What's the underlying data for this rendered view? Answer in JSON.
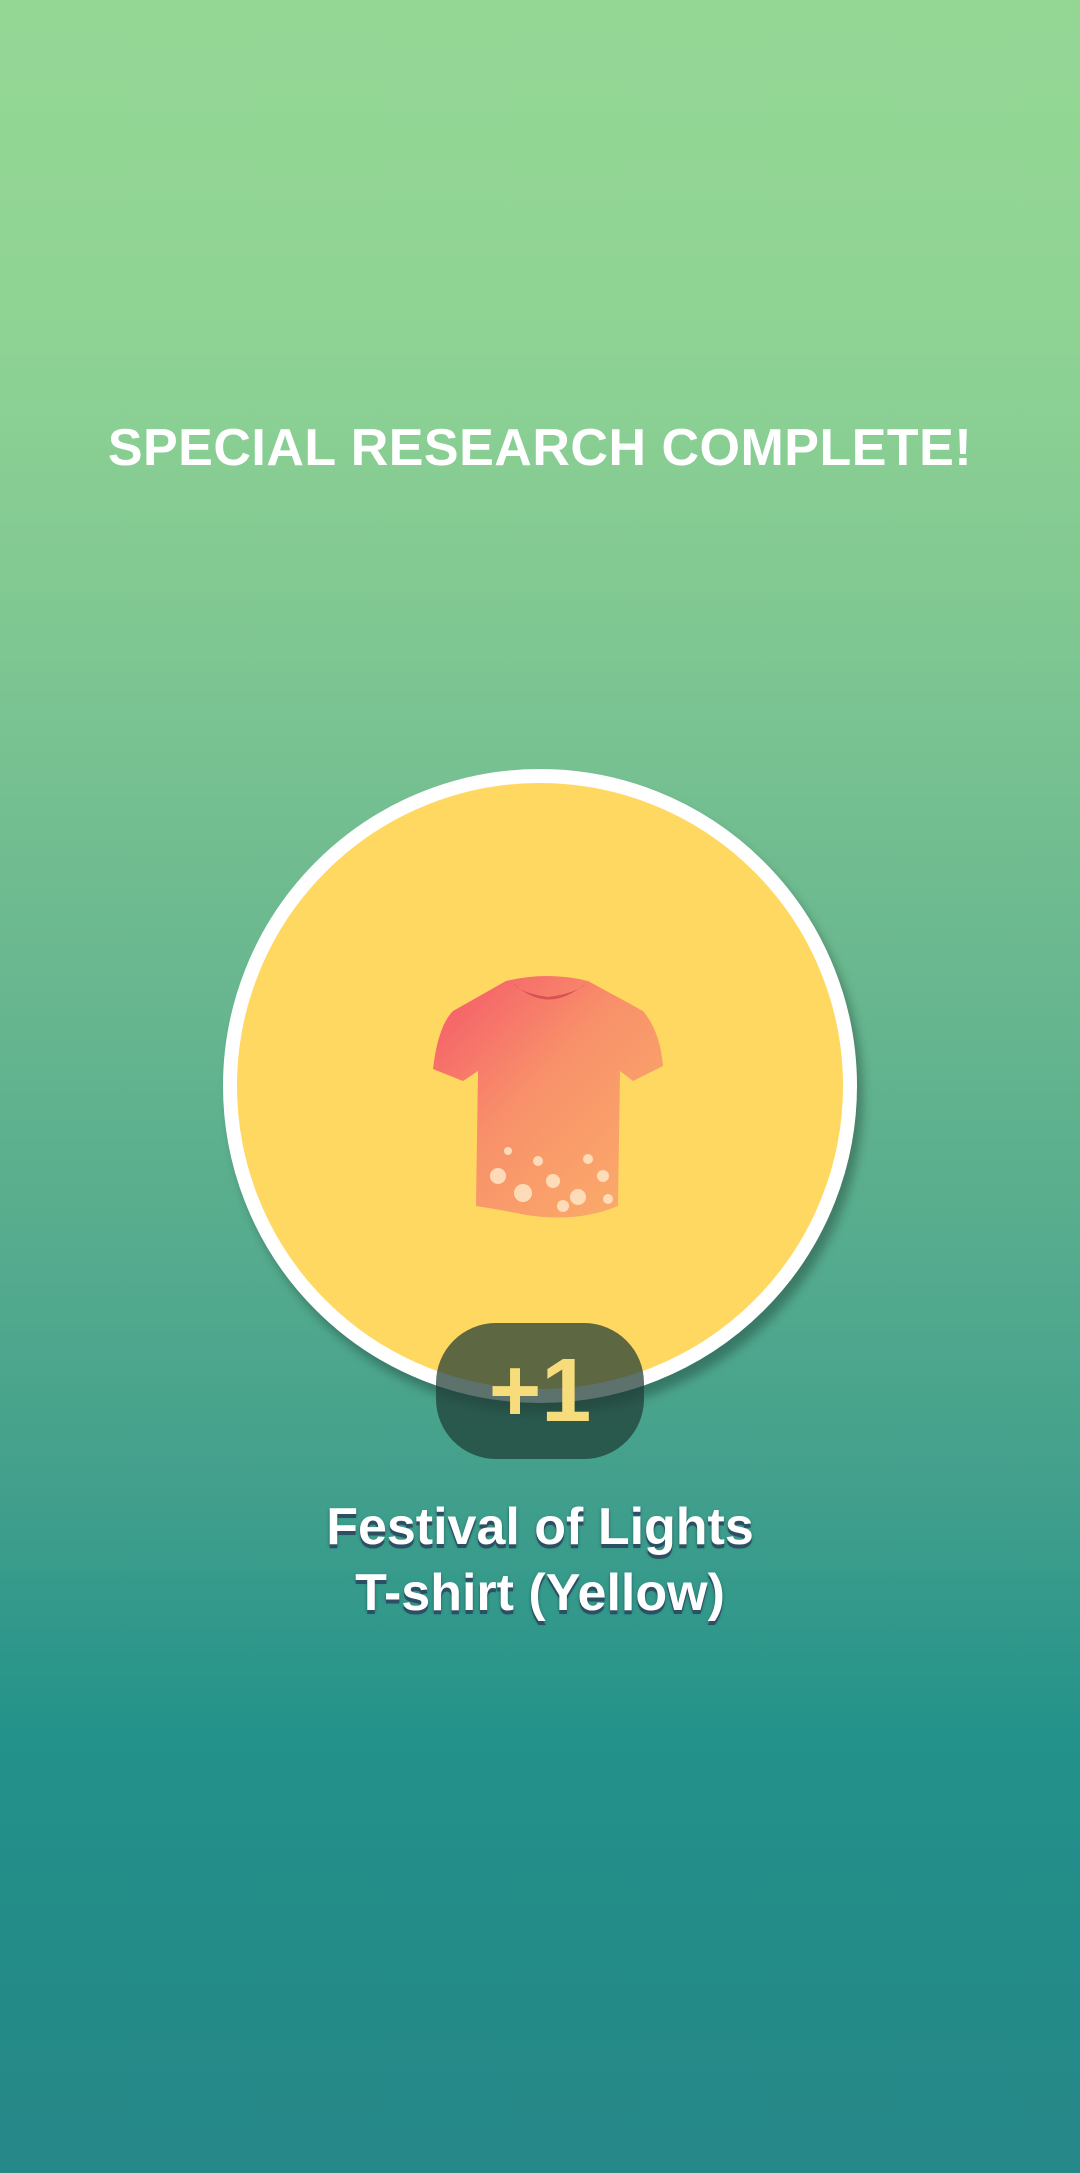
{
  "header": {
    "title": "SPECIAL RESEARCH COMPLETE!"
  },
  "reward": {
    "icon": "tshirt-icon",
    "count": "+1",
    "name_line1": "Festival of Lights",
    "name_line2": "T-shirt (Yellow)"
  },
  "colors": {
    "background_top": "#94d795",
    "background_bottom": "#278889",
    "circle_fill": "#ffd862",
    "circle_border": "#ffffff",
    "count_text": "#f7dc7c"
  }
}
